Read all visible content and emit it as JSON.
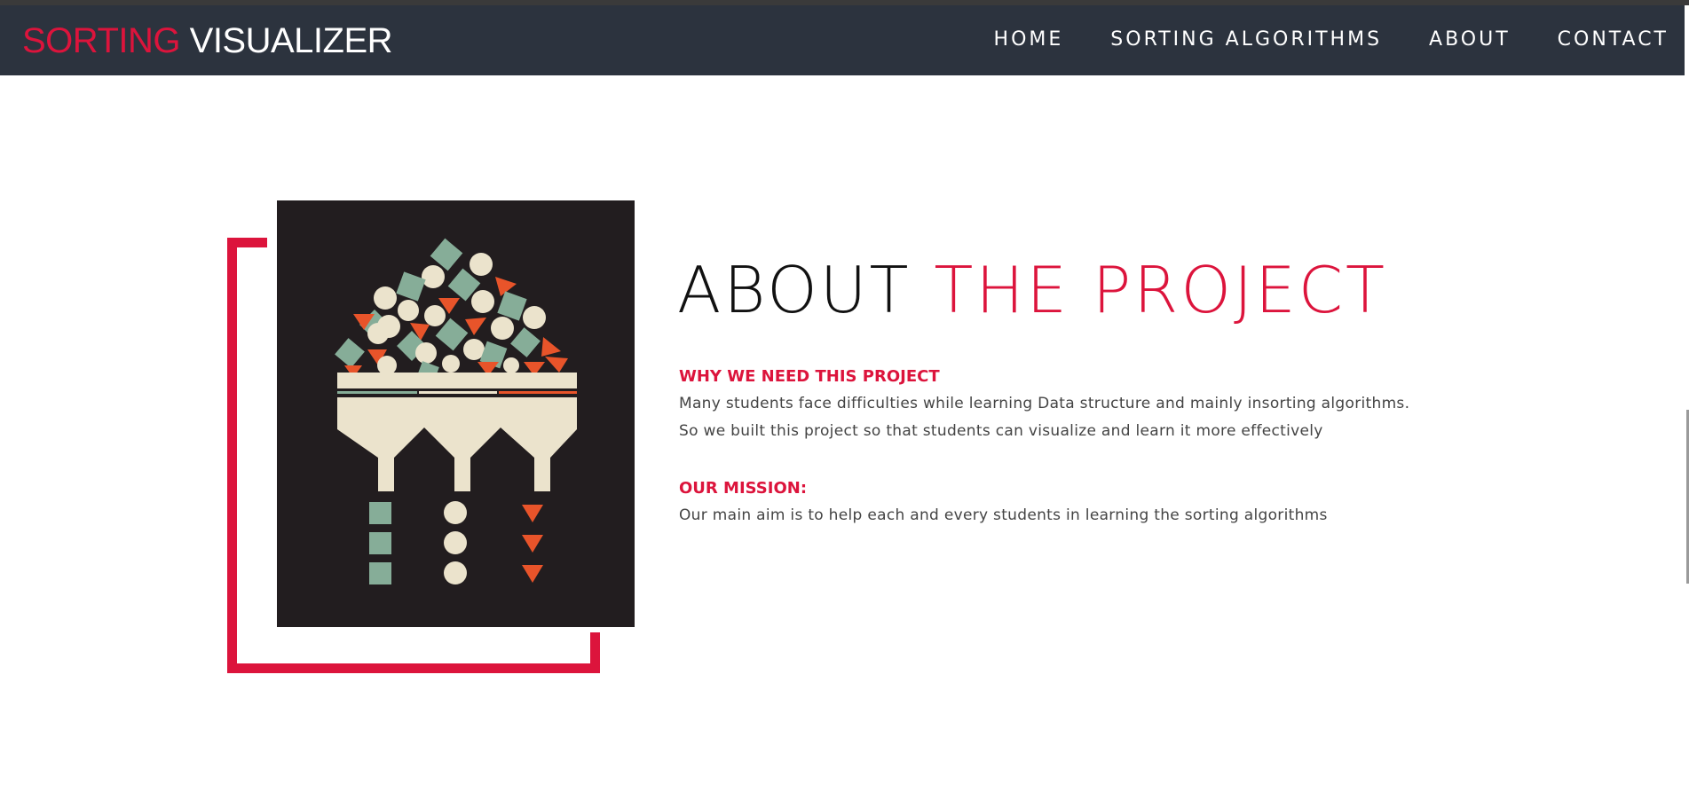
{
  "navbar": {
    "brand_part1": "SORTING",
    "brand_part2": "VISUALIZER",
    "links": [
      "HOME",
      "SORTING ALGORITHMS",
      "ABOUT",
      "CONTACT"
    ]
  },
  "about": {
    "title_part1": "ABOUT",
    "title_part2": "THE PROJECT",
    "why_heading": "WHY WE NEED THIS PROJECT",
    "why_line1": "Many students face difficulties while learning Data structure and mainly insorting algorithms.",
    "why_line2": "So we built this project so that students can visualize and learn it more effectively",
    "mission_heading": "OUR MISSION:",
    "mission_text": "Our main aim is to help each and every students in learning the sorting algorithms",
    "image_icon": "sorting-funnel-illustration"
  },
  "colors": {
    "accent": "#dc143c",
    "navbar_bg": "#2c333e",
    "art_bg": "#221d1f",
    "shape_green": "#86ad98",
    "shape_cream": "#ebe3cc",
    "shape_orange": "#e8542a"
  }
}
